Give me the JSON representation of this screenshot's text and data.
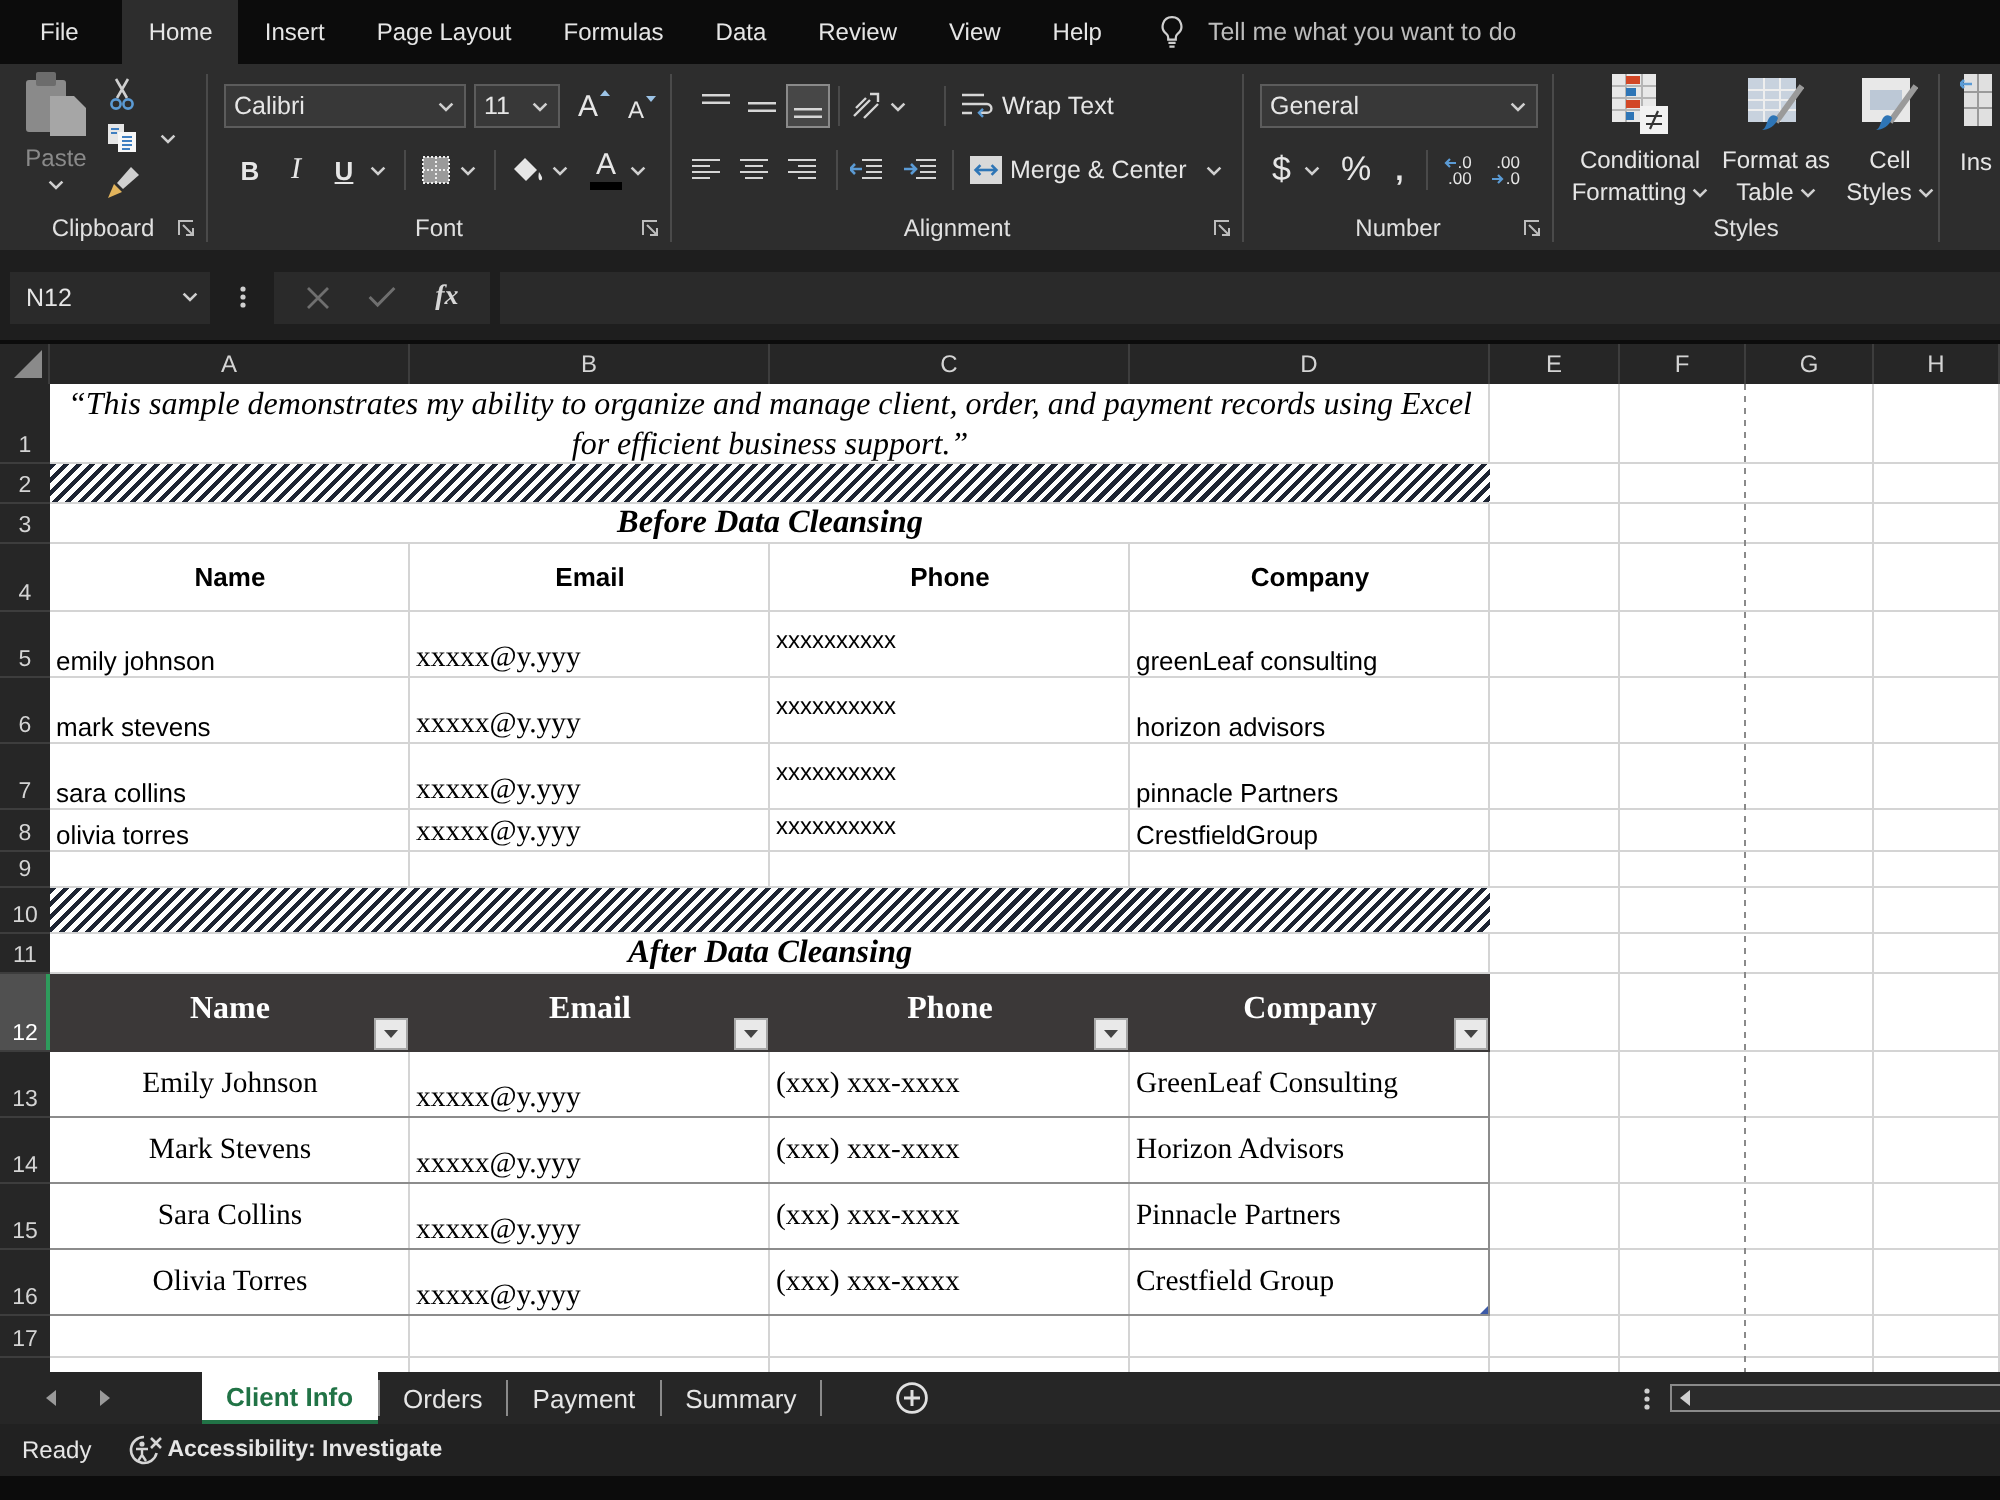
{
  "menu_tabs": [
    {
      "label": "File",
      "selected": false
    },
    {
      "label": "Home",
      "selected": true
    },
    {
      "label": "Insert",
      "selected": false
    },
    {
      "label": "Page Layout",
      "selected": false
    },
    {
      "label": "Formulas",
      "selected": false
    },
    {
      "label": "Data",
      "selected": false
    },
    {
      "label": "Review",
      "selected": false
    },
    {
      "label": "View",
      "selected": false
    },
    {
      "label": "Help",
      "selected": false
    }
  ],
  "tell_me": {
    "placeholder": "Tell me what you want to do"
  },
  "ribbon": {
    "clipboard": {
      "label": "Clipboard",
      "paste": {
        "label": "Paste",
        "disabled": true
      }
    },
    "font": {
      "label": "Font",
      "font_name": "Calibri",
      "font_size": "11",
      "grow_glyph": "A",
      "shrink_glyph": "A",
      "bold": "B",
      "italic": "I",
      "underline": "U",
      "font_color_glyph": "A"
    },
    "alignment": {
      "label": "Alignment",
      "vertical_align": [
        {
          "kind": "top",
          "selected": false
        },
        {
          "kind": "middle",
          "selected": false
        },
        {
          "kind": "bottom",
          "selected": true
        }
      ],
      "wrap_text": "Wrap Text",
      "merge_center": "Merge & Center"
    },
    "number": {
      "label": "Number",
      "format": "General",
      "currency": "$",
      "percent": "%",
      "comma": ",",
      "increase_decimal": [
        ".0",
        ".00"
      ],
      "decrease_decimal": [
        ".00",
        ".0"
      ]
    },
    "styles": {
      "label": "Styles",
      "buttons": [
        {
          "kind": "conditional_formatting",
          "label": "Conditional Formatting"
        },
        {
          "kind": "format_as_table",
          "label": "Format as Table"
        },
        {
          "kind": "cell_styles",
          "label": "Cell Styles"
        }
      ]
    },
    "cells": {
      "label": "Ins"
    }
  },
  "formula_bar": {
    "name_box": "N12",
    "function_button": "fx"
  },
  "sheet": {
    "column_headers": [
      "A",
      "B",
      "C",
      "D",
      "E",
      "F",
      "G",
      "H"
    ],
    "row_headers": [
      {
        "label": "1",
        "selected": false
      },
      {
        "label": "2",
        "selected": false
      },
      {
        "label": "3",
        "selected": false
      },
      {
        "label": "4",
        "selected": false
      },
      {
        "label": "5",
        "selected": false
      },
      {
        "label": "6",
        "selected": false
      },
      {
        "label": "7",
        "selected": false
      },
      {
        "label": "8",
        "selected": false
      },
      {
        "label": "9",
        "selected": false
      },
      {
        "label": "10",
        "selected": false
      },
      {
        "label": "11",
        "selected": false
      },
      {
        "label": "12",
        "selected": true
      },
      {
        "label": "13",
        "selected": false
      },
      {
        "label": "14",
        "selected": false
      },
      {
        "label": "15",
        "selected": false
      },
      {
        "label": "16",
        "selected": false
      },
      {
        "label": "17",
        "selected": false
      }
    ],
    "intro": "“This sample demonstrates my ability to organize and manage client, order, and payment records using Excel for efficient business support.”",
    "sections": [
      {
        "kind": "raw",
        "title": "Before Data Cleansing",
        "columns": [
          "Name",
          "Email",
          "Phone",
          "Company"
        ],
        "rows": [
          [
            "emily johnson",
            "xxxxx@y.yyy",
            "xxxxxxxxxx",
            "greenLeaf consulting"
          ],
          [
            "mark stevens",
            "xxxxx@y.yyy",
            "xxxxxxxxxx",
            "horizon advisors"
          ],
          [
            "sara collins",
            "xxxxx@y.yyy",
            "xxxxxxxxxx",
            "pinnacle Partners"
          ],
          [
            "olivia torres",
            "xxxxx@y.yyy",
            "xxxxxxxxxx",
            "CrestfieldGroup"
          ]
        ]
      },
      {
        "kind": "table",
        "title": "After Data Cleansing",
        "columns": [
          "Name",
          "Email",
          "Phone",
          "Company"
        ],
        "rows": [
          [
            "Emily Johnson",
            "xxxxx@y.yyy",
            "(xxx) xxx-xxxx",
            "GreenLeaf Consulting"
          ],
          [
            "Mark Stevens",
            "xxxxx@y.yyy",
            "(xxx) xxx-xxxx",
            "Horizon Advisors"
          ],
          [
            "Sara Collins",
            "xxxxx@y.yyy",
            "(xxx) xxx-xxxx",
            "Pinnacle Partners"
          ],
          [
            "Olivia Torres",
            "xxxxx@y.yyy",
            "(xxx) xxx-xxxx",
            "Crestfield Group"
          ]
        ]
      }
    ]
  },
  "sheet_tabs": [
    {
      "label": "Client Info",
      "selected": true
    },
    {
      "label": "Orders",
      "selected": false
    },
    {
      "label": "Payment",
      "selected": false
    },
    {
      "label": "Summary",
      "selected": false
    }
  ],
  "status_bar": {
    "mode": "Ready",
    "accessibility": "Accessibility: Investigate"
  }
}
